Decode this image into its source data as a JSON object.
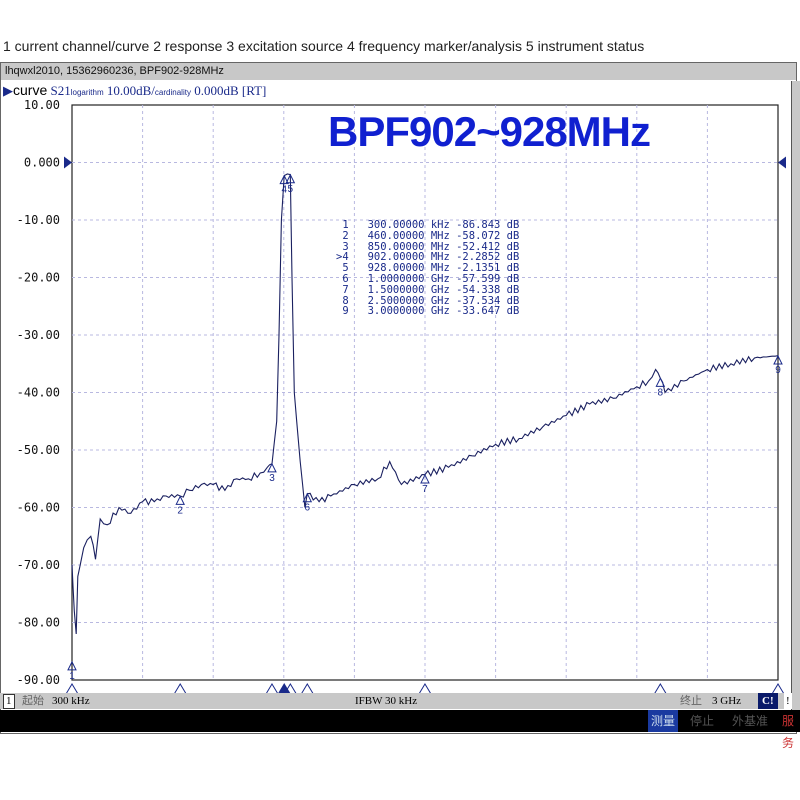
{
  "caption": "1 current channel/curve 2 response 3 excitation source 4 frequency marker/analysis 5 instrument status",
  "window_title": "lhqwxl2010, 15362960236, BPF902-928MHz",
  "header": {
    "label": "curve",
    "param": "S21",
    "format": "logarithm",
    "scale": "10.00dB/",
    "ref_label": "cardinality",
    "ref": "0.000dB",
    "mode": "[RT]"
  },
  "plot_title": "BPF902~928MHz",
  "markers": [
    {
      "n": "1",
      "active": false,
      "freq": "300.00000",
      "unit": "kHz",
      "value": "-86.843",
      "vunit": "dB"
    },
    {
      "n": "2",
      "active": false,
      "freq": "460.00000",
      "unit": "MHz",
      "value": "-58.072",
      "vunit": "dB"
    },
    {
      "n": "3",
      "active": false,
      "freq": "850.00000",
      "unit": "MHz",
      "value": "-52.412",
      "vunit": "dB"
    },
    {
      "n": "4",
      "active": true,
      "freq": "902.00000",
      "unit": "MHz",
      "value": "-2.2852",
      "vunit": "dB"
    },
    {
      "n": "5",
      "active": false,
      "freq": "928.00000",
      "unit": "MHz",
      "value": "-2.1351",
      "vunit": "dB"
    },
    {
      "n": "6",
      "active": false,
      "freq": "1.0000000",
      "unit": "GHz",
      "value": "-57.599",
      "vunit": "dB"
    },
    {
      "n": "7",
      "active": false,
      "freq": "1.5000000",
      "unit": "GHz",
      "value": "-54.338",
      "vunit": "dB"
    },
    {
      "n": "8",
      "active": false,
      "freq": "2.5000000",
      "unit": "GHz",
      "value": "-37.534",
      "vunit": "dB"
    },
    {
      "n": "9",
      "active": false,
      "freq": "3.0000000",
      "unit": "GHz",
      "value": "-33.647",
      "vunit": "dB"
    }
  ],
  "status": {
    "channel": "1",
    "start_label": "起始",
    "start": "300 kHz",
    "ifbw": "IFBW 30 kHz",
    "stop_label": "终止",
    "stop": "3 GHz",
    "cal": "C!",
    "flag": "!"
  },
  "bottom": [
    "测量",
    "停止",
    "外基准",
    "服务"
  ],
  "colors": {
    "trace": "#1a2060",
    "grid": "#b8b8e0",
    "marker": "#1a2a8a",
    "title": "#1020d0"
  },
  "chart_data": {
    "type": "line",
    "xlim_mhz": [
      0.3,
      3000
    ],
    "ylim": [
      -90,
      10
    ],
    "yticks": [
      "10.00",
      "0.000",
      "-10.00",
      "-20.00",
      "-30.00",
      "-40.00",
      "-50.00",
      "-60.00",
      "-70.00",
      "-80.00",
      "-90.00"
    ],
    "grid": true,
    "marker_mhz": [
      0.3,
      460,
      850,
      902,
      928,
      1000,
      1500,
      2500,
      3000
    ],
    "marker_db": [
      -86.843,
      -58.072,
      -52.412,
      -2.2852,
      -2.1351,
      -57.599,
      -54.338,
      -37.534,
      -33.647
    ],
    "trace_mhz": [
      0.3,
      5,
      10,
      18,
      25,
      35,
      50,
      80,
      100,
      120,
      150,
      200,
      250,
      300,
      350,
      400,
      460,
      500,
      550,
      600,
      650,
      700,
      750,
      800,
      830,
      850,
      870,
      880,
      890,
      902,
      915,
      928,
      935,
      945,
      955,
      970,
      990,
      1000,
      1050,
      1100,
      1200,
      1300,
      1350,
      1400,
      1500,
      1600,
      1700,
      1800,
      1900,
      2000,
      2100,
      2200,
      2300,
      2400,
      2450,
      2480,
      2500,
      2520,
      2600,
      2700,
      2800,
      2900,
      3000
    ],
    "trace_db": [
      -70,
      -74,
      -78,
      -82,
      -72,
      -70,
      -67,
      -65,
      -69,
      -62,
      -63,
      -60,
      -61,
      -59,
      -59,
      -58,
      -58,
      -57,
      -56,
      -56,
      -57,
      -55,
      -55,
      -54,
      -53,
      -52.4,
      -45,
      -30,
      -10,
      -2.3,
      -2,
      -2.1,
      -20,
      -40,
      -45,
      -52,
      -60,
      -57.6,
      -59,
      -58,
      -56,
      -55,
      -52,
      -56,
      -54.3,
      -53,
      -51,
      -49,
      -48,
      -46,
      -44,
      -42,
      -41,
      -39,
      -38,
      -36,
      -37.5,
      -40,
      -38,
      -36,
      -35,
      -34,
      -33.6
    ]
  }
}
